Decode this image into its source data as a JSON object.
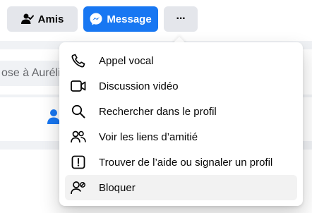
{
  "actions": {
    "friends_label": "Amis",
    "message_label": "Message",
    "more_label": "···"
  },
  "composer": {
    "partial_text": "ose à Auréli"
  },
  "menu": {
    "items": [
      {
        "label": "Appel vocal",
        "icon": "phone-icon"
      },
      {
        "label": "Discussion vidéo",
        "icon": "video-camera-icon"
      },
      {
        "label": "Rechercher dans le profil",
        "icon": "search-icon"
      },
      {
        "label": "Voir les liens d’amitié",
        "icon": "friends-icon"
      },
      {
        "label": "Trouver de l’aide ou signaler un profil",
        "icon": "report-icon"
      },
      {
        "label": "Bloquer",
        "icon": "block-user-icon"
      }
    ],
    "hovered_item": "Bloquer"
  },
  "colors": {
    "brand_blue": "#1877f2",
    "button_gray": "#e4e6eb",
    "page_bg": "#f0f2f5",
    "hover_bg": "#f2f2f2"
  }
}
